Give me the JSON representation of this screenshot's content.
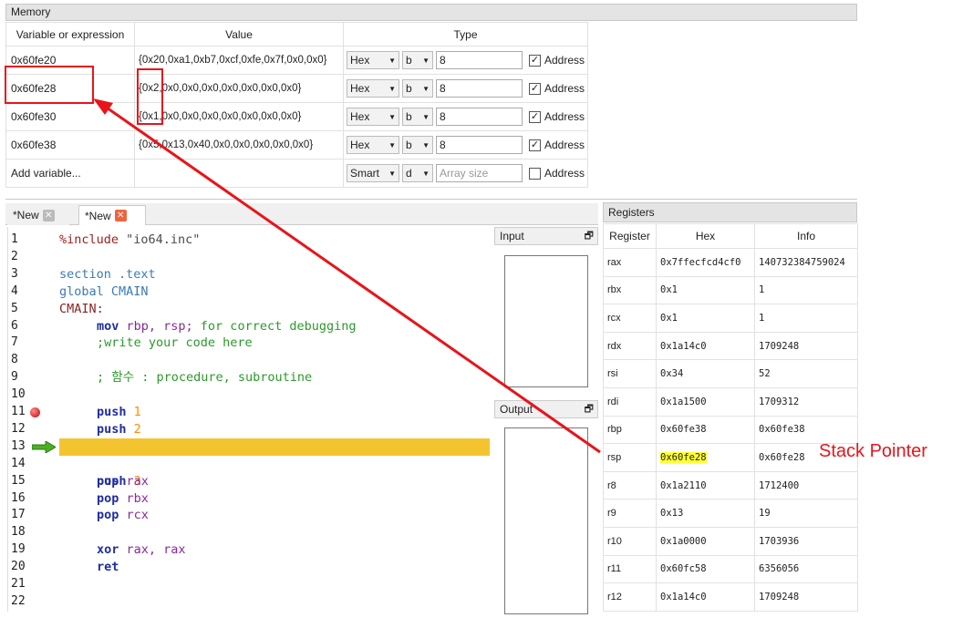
{
  "memory": {
    "title": "Memory",
    "columns": [
      "Variable or expression",
      "Value",
      "Type"
    ],
    "rows": [
      {
        "var": "0x60fe20",
        "value": "{0x20,0xa1,0xb7,0xcf,0xfe,0x7f,0x0,0x0}",
        "format": "Hex",
        "unit": "b",
        "size": "8",
        "address_label": "Address",
        "address_checked": "✓"
      },
      {
        "var": "0x60fe28",
        "value": "{0x2,0x0,0x0,0x0,0x0,0x0,0x0,0x0}",
        "format": "Hex",
        "unit": "b",
        "size": "8",
        "address_label": "Address",
        "address_checked": "✓"
      },
      {
        "var": "0x60fe30",
        "value": "{0x1,0x0,0x0,0x0,0x0,0x0,0x0,0x0}",
        "format": "Hex",
        "unit": "b",
        "size": "8",
        "address_label": "Address",
        "address_checked": "✓"
      },
      {
        "var": "0x60fe38",
        "value": "{0x5,0x13,0x40,0x0,0x0,0x0,0x0,0x0}",
        "format": "Hex",
        "unit": "b",
        "size": "8",
        "address_label": "Address",
        "address_checked": "✓"
      }
    ],
    "add_row": {
      "var": "Add variable...",
      "format": "Smart",
      "unit": "d",
      "size_placeholder": "Array size",
      "address_label": "Address"
    }
  },
  "editor": {
    "tabs": [
      {
        "label": "*New",
        "close": "✕"
      },
      {
        "label": "*New",
        "close": "✕"
      }
    ],
    "line_numbers": [
      "1",
      "2",
      "3",
      "4",
      "5",
      "6",
      "7",
      "8",
      "9",
      "10",
      "11",
      "12",
      "13",
      "14",
      "15",
      "16",
      "17",
      "18",
      "19",
      "20",
      "21",
      "22"
    ],
    "lines": {
      "l1_pre": "%include",
      "l1_str": " \"io64.inc\"",
      "l3_kw": "section .text",
      "l4_kw": "global CMAIN",
      "l5_lbl": "CMAIN:",
      "l6_ins": "mov",
      "l6_regs": " rbp, rsp;",
      "l6_cmt": " for correct debugging",
      "l7_cmt": ";write your code here",
      "l9_cmt": "; 함수 : procedure, subroutine",
      "l11_ins": "push",
      "l11_num": " 1",
      "l12_ins": "push",
      "l12_num": " 2",
      "l13_ins": "push",
      "l13_num": " 3",
      "l15_ins": "pop",
      "l15_reg": " rax",
      "l16_ins": "pop",
      "l16_reg": " rbx",
      "l17_ins": "pop",
      "l17_reg": " rcx",
      "l19_ins": "xor",
      "l19_reg": " rax, rax",
      "l20_ins": "ret"
    },
    "breakpoint_line": "11",
    "current_line": "13"
  },
  "io": {
    "input_title": "Input",
    "output_title": "Output",
    "pin_icon": "🗗"
  },
  "registers": {
    "title": "Registers",
    "columns": [
      "Register",
      "Hex",
      "Info"
    ],
    "rows": [
      {
        "name": "rax",
        "hex": "0x7ffecfcd4cf0",
        "info": "140732384759024"
      },
      {
        "name": "rbx",
        "hex": "0x1",
        "info": "1"
      },
      {
        "name": "rcx",
        "hex": "0x1",
        "info": "1"
      },
      {
        "name": "rdx",
        "hex": "0x1a14c0",
        "info": "1709248"
      },
      {
        "name": "rsi",
        "hex": "0x34",
        "info": "52"
      },
      {
        "name": "rdi",
        "hex": "0x1a1500",
        "info": "1709312"
      },
      {
        "name": "rbp",
        "hex": "0x60fe38",
        "info": "0x60fe38"
      },
      {
        "name": "rsp",
        "hex": "0x60fe28",
        "info": "0x60fe28"
      },
      {
        "name": "r8",
        "hex": "0x1a2110",
        "info": "1712400"
      },
      {
        "name": "r9",
        "hex": "0x13",
        "info": "19"
      },
      {
        "name": "r10",
        "hex": "0x1a0000",
        "info": "1703936"
      },
      {
        "name": "r11",
        "hex": "0x60fc58",
        "info": "6356056"
      },
      {
        "name": "r12",
        "hex": "0x1a14c0",
        "info": "1709248"
      }
    ]
  },
  "annotation": {
    "label": "Stack Pointer",
    "color": "#e8141a",
    "highlight_color": "#ffff33"
  }
}
